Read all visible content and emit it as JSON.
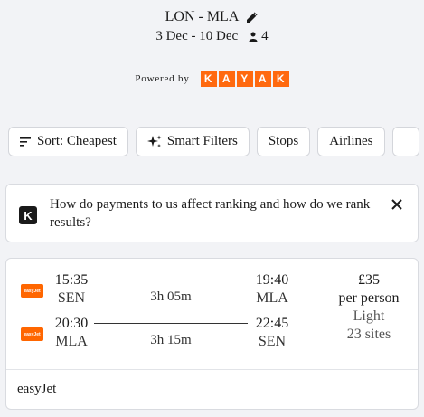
{
  "header": {
    "route": "LON - MLA",
    "dates": "3 Dec - 10 Dec",
    "travelers": "4",
    "powered_by": "Powered by",
    "brand_letters": [
      "K",
      "A",
      "Y",
      "A",
      "K"
    ]
  },
  "filters": [
    {
      "label": "Sort: Cheapest",
      "icon": "sort-icon"
    },
    {
      "label": "Smart Filters",
      "icon": "sparkle-icon"
    },
    {
      "label": "Stops",
      "icon": ""
    },
    {
      "label": "Airlines",
      "icon": ""
    }
  ],
  "banner": {
    "icon_letter": "K",
    "text": "How do payments to us affect ranking and how do we rank results?"
  },
  "result": {
    "airline_logo_text": "easyJet",
    "legs": [
      {
        "dep_time": "15:35",
        "dep_code": "SEN",
        "duration": "3h 05m",
        "arr_time": "19:40",
        "arr_code": "MLA"
      },
      {
        "dep_time": "20:30",
        "dep_code": "MLA",
        "duration": "3h 15m",
        "arr_time": "22:45",
        "arr_code": "SEN"
      }
    ],
    "price": "£35",
    "price_unit": "per person",
    "cabin": "Light",
    "sites": "23 sites",
    "carrier": "easyJet"
  },
  "colors": {
    "brand": "#ff690f",
    "airline": "#ff6600",
    "background": "#f2f3f6"
  }
}
